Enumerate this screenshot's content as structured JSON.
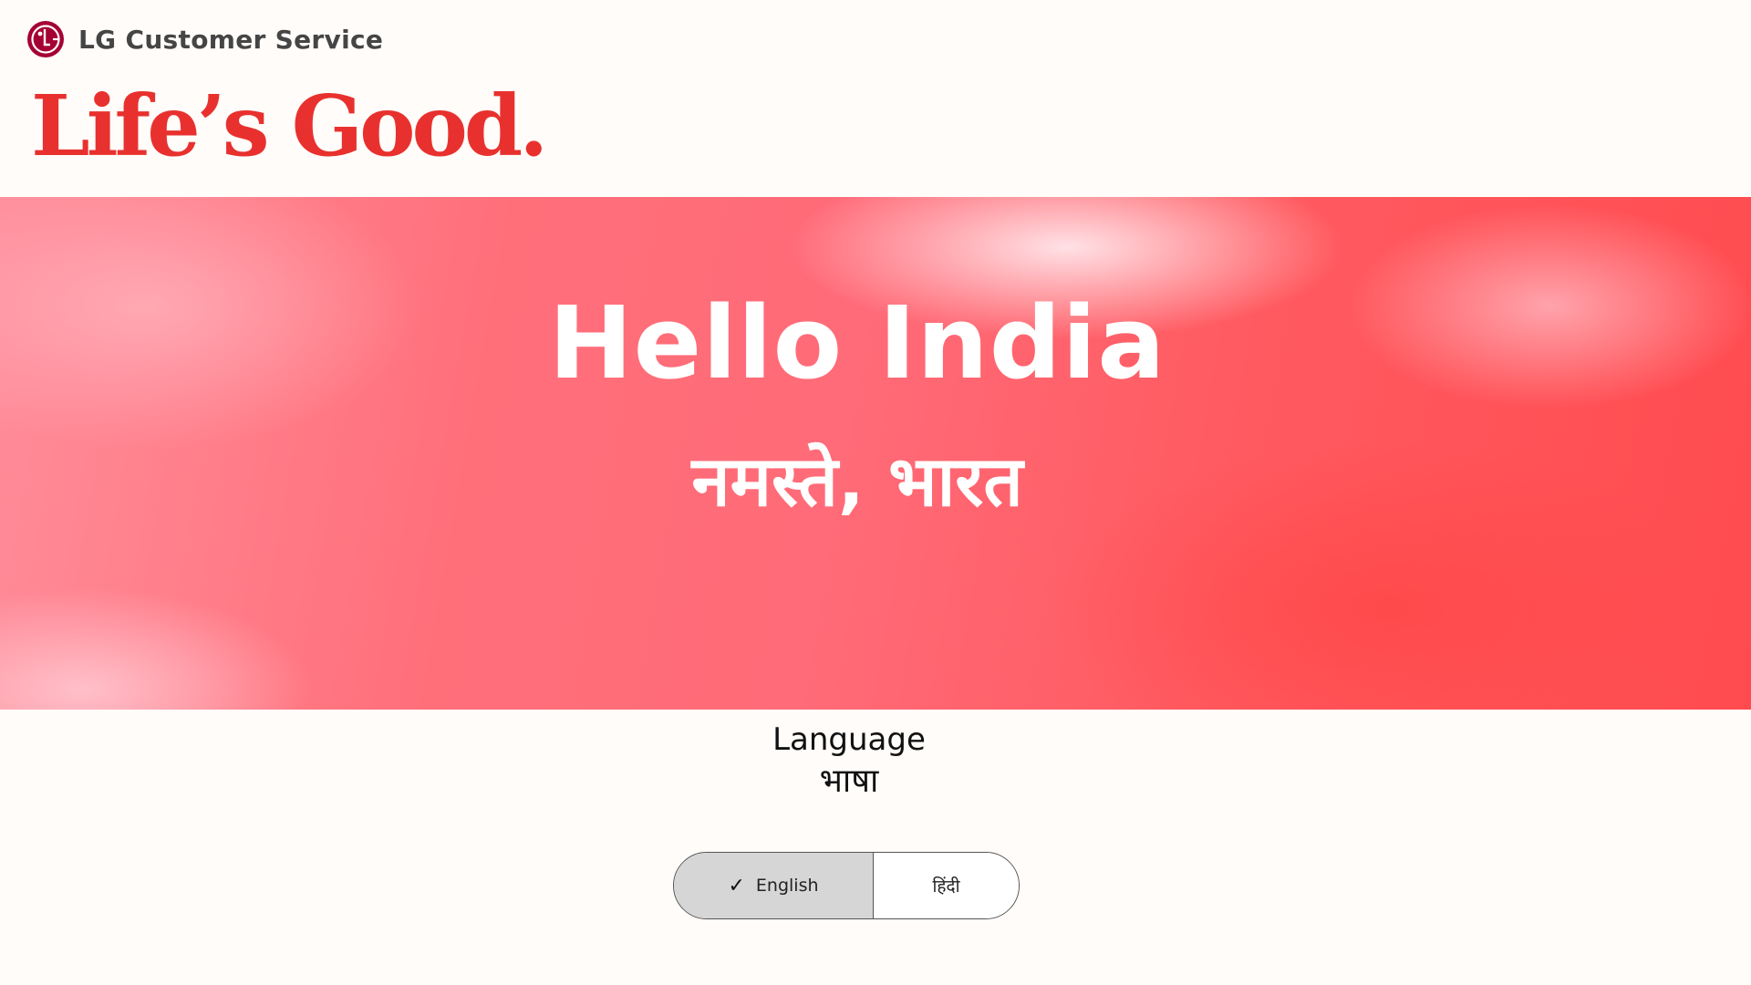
{
  "header": {
    "brand_name": "LG Customer Service",
    "logo_icon": "lg-logo-icon",
    "tagline": "Life’s Good."
  },
  "hero": {
    "title": "Hello India",
    "subtitle": "नमस्ते, भारत"
  },
  "language": {
    "heading": "Language",
    "heading_hindi": "भाषा",
    "options": [
      {
        "label": "English",
        "selected": true,
        "icon": "check-icon"
      },
      {
        "label": "हिंदी",
        "selected": false
      }
    ]
  },
  "colors": {
    "brand_red": "#e8312e",
    "logo_red": "#a50034",
    "selected_bg": "#d6d6d6"
  }
}
